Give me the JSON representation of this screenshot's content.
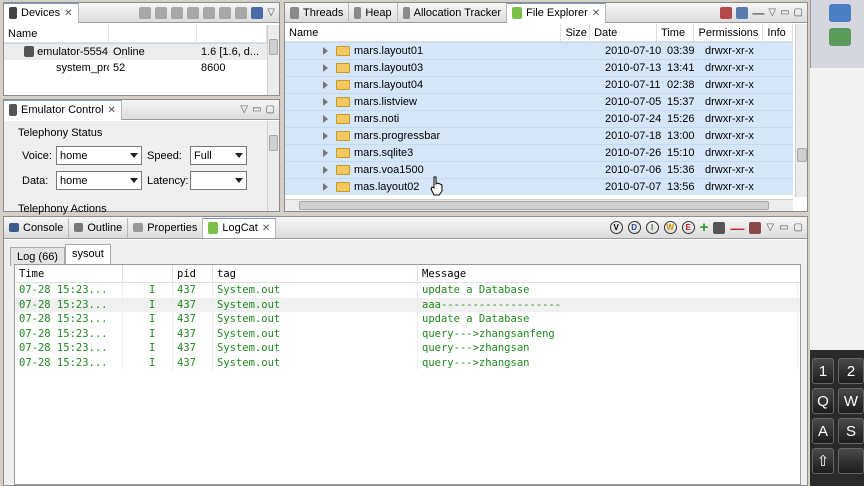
{
  "devices": {
    "tab_label": "Devices",
    "columns": [
      "Name",
      "",
      ""
    ],
    "rows": [
      {
        "name": "emulator-5554",
        "status": "Online",
        "extra": "1.6 [1.6, d..."
      },
      {
        "name": "system_process",
        "status": "52",
        "extra": "8600"
      }
    ]
  },
  "emulator_control": {
    "tab_label": "Emulator Control",
    "telephony_status": "Telephony Status",
    "voice_label": "Voice:",
    "voice_value": "home",
    "speed_label": "Speed:",
    "speed_value": "Full",
    "data_label": "Data:",
    "data_value": "home",
    "latency_label": "Latency:",
    "latency_value": "",
    "telephony_actions": "Telephony Actions"
  },
  "ddms_tabs": [
    {
      "label": "Threads",
      "icon": "threads-icon"
    },
    {
      "label": "Heap",
      "icon": "heap-icon"
    },
    {
      "label": "Allocation Tracker",
      "icon": "allocation-icon"
    },
    {
      "label": "File Explorer",
      "icon": "file-explorer-icon"
    }
  ],
  "file_explorer": {
    "columns": [
      "Name",
      "Size",
      "Date",
      "Time",
      "Permissions",
      "Info"
    ],
    "rows": [
      {
        "name": "mars.layout01",
        "size": "",
        "date": "2010-07-10",
        "time": "03:39",
        "perm": "drwxr-xr-x"
      },
      {
        "name": "mars.layout03",
        "size": "",
        "date": "2010-07-13",
        "time": "13:41",
        "perm": "drwxr-xr-x"
      },
      {
        "name": "mars.layout04",
        "size": "",
        "date": "2010-07-11",
        "time": "02:38",
        "perm": "drwxr-xr-x"
      },
      {
        "name": "mars.listview",
        "size": "",
        "date": "2010-07-05",
        "time": "15:37",
        "perm": "drwxr-xr-x"
      },
      {
        "name": "mars.noti",
        "size": "",
        "date": "2010-07-24",
        "time": "15:26",
        "perm": "drwxr-xr-x"
      },
      {
        "name": "mars.progressbar",
        "size": "",
        "date": "2010-07-18",
        "time": "13:00",
        "perm": "drwxr-xr-x"
      },
      {
        "name": "mars.sqlite3",
        "size": "",
        "date": "2010-07-26",
        "time": "15:10",
        "perm": "drwxr-xr-x"
      },
      {
        "name": "mars.voa1500",
        "size": "",
        "date": "2010-07-06",
        "time": "15:36",
        "perm": "drwxr-xr-x"
      },
      {
        "name": "mas.layout02",
        "size": "",
        "date": "2010-07-07",
        "time": "13:56",
        "perm": "drwxr-xr-x"
      }
    ]
  },
  "bottom_tabs": [
    {
      "label": "Console",
      "icon": "console-icon"
    },
    {
      "label": "Outline",
      "icon": "outline-icon"
    },
    {
      "label": "Properties",
      "icon": "properties-icon"
    },
    {
      "label": "LogCat",
      "icon": "logcat-icon"
    }
  ],
  "log_level_buttons": [
    "V",
    "D",
    "I",
    "W",
    "E"
  ],
  "logcat": {
    "subtabs": [
      "Log (66)",
      "sysout"
    ],
    "columns": [
      "Time",
      "",
      "pid",
      "tag",
      "Message"
    ],
    "rows": [
      {
        "time": "07-28 15:23...",
        "level": "I",
        "pid": "437",
        "tag": "System.out",
        "msg": "update a Database"
      },
      {
        "time": "07-28 15:23...",
        "level": "I",
        "pid": "437",
        "tag": "System.out",
        "msg": "aaa-------------------"
      },
      {
        "time": "07-28 15:23...",
        "level": "I",
        "pid": "437",
        "tag": "System.out",
        "msg": "update a Database"
      },
      {
        "time": "07-28 15:23...",
        "level": "I",
        "pid": "437",
        "tag": "System.out",
        "msg": "query--->zhangsanfeng"
      },
      {
        "time": "07-28 15:23...",
        "level": "I",
        "pid": "437",
        "tag": "System.out",
        "msg": "query--->zhangsan"
      },
      {
        "time": "07-28 15:23...",
        "level": "I",
        "pid": "437",
        "tag": "System.out",
        "msg": "query--->zhangsan"
      }
    ]
  },
  "keyboard": {
    "keys": [
      "1",
      "2",
      "Q",
      "W",
      "A",
      "S"
    ]
  },
  "colors": {
    "selection": "#d6e6f9",
    "log_green": "#1e8a1e",
    "desktop": "#3a6ea5"
  }
}
